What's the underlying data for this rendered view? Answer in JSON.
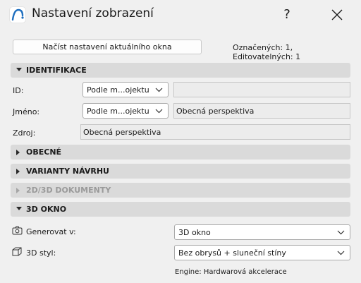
{
  "window": {
    "title": "Nastavení zobrazení",
    "help_label": "?"
  },
  "toolbar": {
    "load_button": "Načíst nastavení aktuálního okna",
    "counts": "Označených: 1, Editovatelných: 1"
  },
  "sections": {
    "identifikace": "IDENTIFIKACE",
    "obecne": "OBECNÉ",
    "varianty": "VARIANTY NÁVRHU",
    "dokumenty": "2D/3D DOKUMENTY",
    "okno3d": "3D OKNO"
  },
  "identification": {
    "id_label": "ID:",
    "id_mode": "Podle m...ojektu",
    "id_value": "",
    "name_label": "Jméno:",
    "name_mode": "Podle m...ojektu",
    "name_value": "Obecná perspektiva",
    "source_label": "Zdroj:",
    "source_value": "Obecná perspektiva"
  },
  "window3d": {
    "generate_label": "Generovat v:",
    "generate_value": "3D okno",
    "style_label": "3D styl:",
    "style_value": "Bez obrysů + sluneční stíny",
    "engine": "Engine: Hardwarová akcelerace"
  },
  "colors": {
    "section_bg": "#dadada",
    "window_bg": "#f0f0f0",
    "accent": "#1f6fbf"
  }
}
